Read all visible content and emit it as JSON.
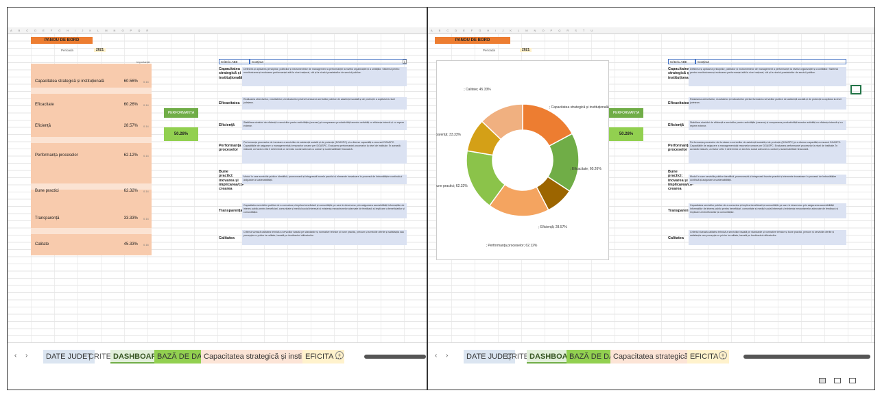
{
  "title": "PANOU DE BORD",
  "period_label": "Perioada",
  "period_value": "2021",
  "importance_label": "Importanță",
  "criteria": [
    {
      "name": "Capacitatea strategică și instituțională",
      "pct": "60.56%",
      "weight": "0.14"
    },
    {
      "name": "Eficacitate",
      "pct": "60.26%",
      "weight": "0.14"
    },
    {
      "name": "Eficiență",
      "pct": "28.57%",
      "weight": "0.14"
    },
    {
      "name": "Performanța proceselor",
      "pct": "62.12%",
      "weight": "0.14"
    },
    {
      "name": "Bune practici",
      "pct": "62.32%",
      "weight": "0.14"
    },
    {
      "name": "Transparență",
      "pct": "33.33%",
      "weight": "0.14"
    },
    {
      "name": "Calitate",
      "pct": "45.33%",
      "weight": "0.16"
    }
  ],
  "aggregate": {
    "label": "PERFORMANȚA AGREGATĂ",
    "value": "50.28%"
  },
  "table": {
    "header_col1": "Criteriu ABE",
    "header_col2": "Conținut",
    "rows": [
      {
        "label": "Capacitatea strategică și instituțională",
        "text": "Definirea și aplicarea principiilor, politicilor și instrumentelor de management a performanței la nivelul organizației și a unităților. Sistemul pentru monitorizarea și evaluarea performanței atât la nivel național, cât și la nivelul prestatorilor de servicii publice."
      },
      {
        "label": "Eficacitatea",
        "text": "Realizarea obiectivelor, rezultatelor și indicatorilor privind furnizarea serviciilor publice de asistență socială și de protecție a copilului la nivel județean."
      },
      {
        "label": "Eficiență",
        "text": "Stabilirea nivelului de eficiență a serviciilor pentru activitățile (resurse) și compararea productivității acestor activități cu eficiența internă și cu repere externe."
      },
      {
        "label": "Performanța proceselor",
        "text": "Performanța proceselor de furnizare a serviciilor de asistență socială și de protecție (DGASPC) și a diverse capacități a resursei DGASPC. Capacitățile de asigurare a managementului resurselor umane per DGASPC. Evaluarea performanței proceselor la nivel de instituție. În această măsură, un factor critic îl determină un serviciu social adecvat cu costuri și sustenabilitate financiară."
      },
      {
        "label": "Bune practici: inovarea și implicarea/co-crearea",
        "text": "Modul în care serviciile publice identifică, promovează și integrează bunele practici și elemente inovatoare în procesul de îmbunătățire continuă și asigurare a sustenabilității."
      },
      {
        "label": "Transparența",
        "text": "Capacitatea serviciilor publice de a comunica și implica beneficiarii și comunitățile pe care le deservesc prin asigurarea accesibilității informațiilor de interes public pentru beneficiari, comunitate și mediul social interesat și existența mecanismelor adecvate de feedback și implicare a beneficiarilor și comunităților."
      },
      {
        "label": "Calitatea",
        "text": "Criteriul vizează calitatea tehnică a serviciilor bazată pe standarde și normative tehnice și bune practici, precum și serviciile oferite și satisfacția sau percepția cu privire la calitate, bazată pe feedbackul utilizatorilor."
      }
    ]
  },
  "tabs_left": [
    "DATE JUDEȚ",
    "CRITERII",
    "DASHBOARD",
    "BAZĂ DE DATE",
    "Capacitatea strategică și insti",
    "EFICITA ..."
  ],
  "tabs_right": [
    "DATE JUDEȚ",
    "CRITERII",
    "DASHBOARD",
    "BAZĂ DE DATE",
    "Capacitatea strategică și insti",
    "EFICITA ..."
  ],
  "colors": {
    "orange": "#ed7d31",
    "peach": "#f8cbad",
    "green": "#70ad47",
    "blue_row": "#dbe2f2"
  },
  "chart_data": {
    "type": "pie",
    "donut": true,
    "categories": [
      "Capacitatea strategică și instituțională",
      "Eficacitate",
      "Eficiență",
      "Performanța proceselor",
      "Bune practici",
      "Transparență",
      "Calitate"
    ],
    "values": [
      60.56,
      60.26,
      28.57,
      62.12,
      62.32,
      33.33,
      45.33
    ],
    "labels": [
      "; Capacitatea strategică și instituțională; 60.56%",
      "; Eficacitate; 60.26%",
      "; Eficiență; 28.57%",
      "; Performanța proceselor; 62.12%",
      "; Bune practici; 62.32%",
      "; Transparență; 33.33%",
      "; Calitate; 45.33%"
    ],
    "colors": [
      "#ed7d31",
      "#70ad47",
      "#9c6500",
      "#f4a460",
      "#8bc34a",
      "#d4a017",
      "#f0b080"
    ]
  }
}
